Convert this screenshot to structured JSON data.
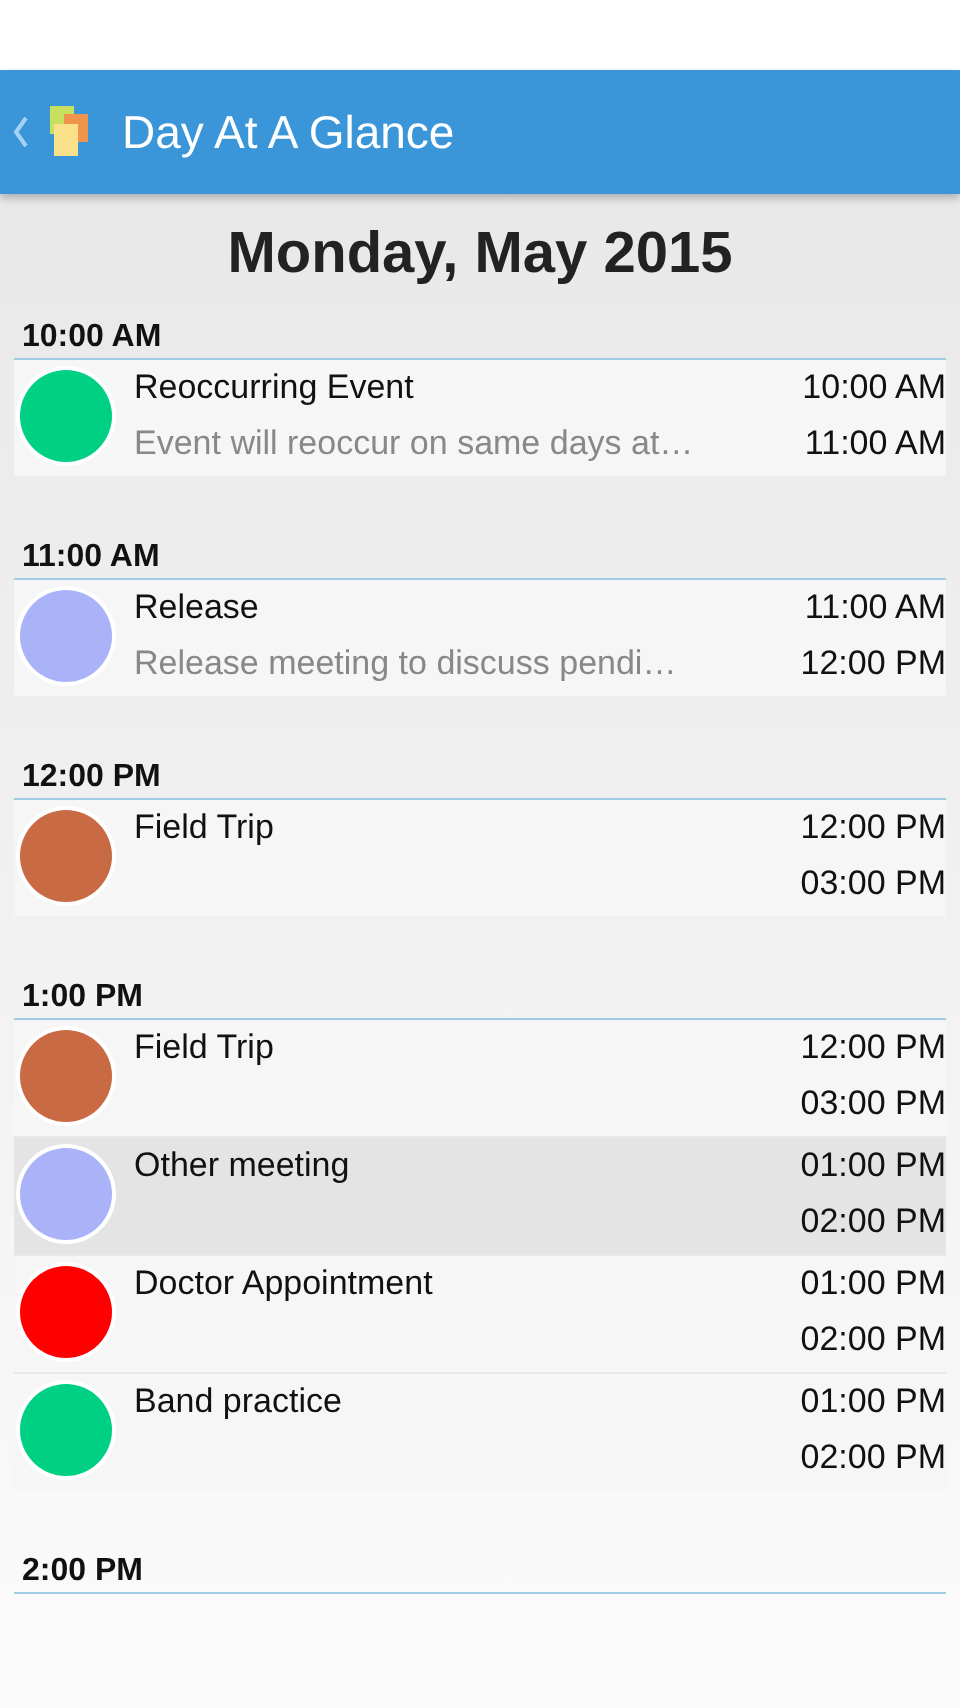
{
  "app_bar": {
    "title": "Day At A Glance"
  },
  "heading": "Monday, May 2015",
  "sections": [
    {
      "time": "10:00 AM",
      "events": [
        {
          "title": "Reoccurring Event",
          "note": "Event will reoccur on same days at…",
          "start": "10:00 AM",
          "end": "11:00 AM",
          "color": "#00d084",
          "selected": false
        }
      ]
    },
    {
      "time": "11:00 AM",
      "events": [
        {
          "title": "Release",
          "note": "Release meeting to discuss pendi…",
          "start": "11:00 AM",
          "end": "12:00 PM",
          "color": "#aab2f8",
          "selected": false
        }
      ]
    },
    {
      "time": "12:00 PM",
      "events": [
        {
          "title": "Field Trip",
          "start": "12:00 PM",
          "end": "03:00 PM",
          "color": "#c86a44",
          "selected": false
        }
      ]
    },
    {
      "time": "1:00 PM",
      "events": [
        {
          "title": "Field Trip",
          "start": "12:00 PM",
          "end": "03:00 PM",
          "color": "#c86a44",
          "selected": false
        },
        {
          "title": "Other meeting",
          "start": "01:00 PM",
          "end": "02:00 PM",
          "color": "#aab2f8",
          "selected": true
        },
        {
          "title": "Doctor Appointment",
          "start": "01:00 PM",
          "end": "02:00 PM",
          "color": "#ff0000",
          "selected": false
        },
        {
          "title": "Band practice",
          "start": "01:00 PM",
          "end": "02:00 PM",
          "color": "#00d084",
          "selected": false
        }
      ]
    },
    {
      "time": "2:00 PM"
    }
  ]
}
